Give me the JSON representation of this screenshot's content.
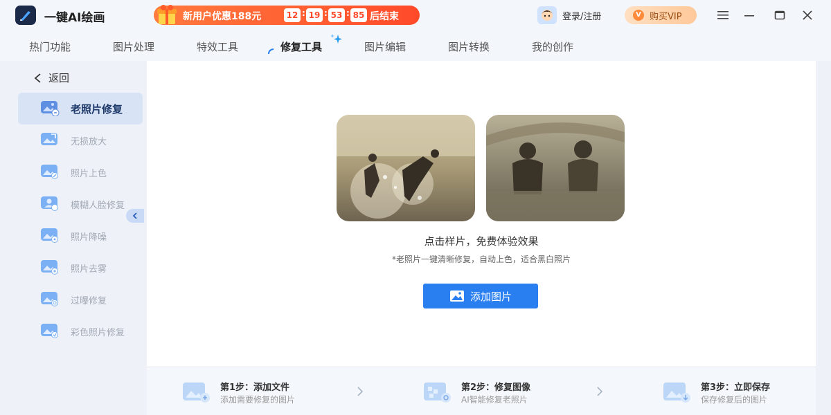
{
  "app": {
    "title": "一键AI绘画"
  },
  "promo": {
    "text": "新用户优惠188元",
    "countdown": [
      "12",
      "19",
      "53",
      "85"
    ],
    "end_text": "后结束"
  },
  "header": {
    "login_label": "登录/注册",
    "vip_badge": "V",
    "vip_label": "购买VIP"
  },
  "tabs": [
    {
      "label": "热门功能"
    },
    {
      "label": "图片处理"
    },
    {
      "label": "特效工具"
    },
    {
      "label": "修复工具"
    },
    {
      "label": "图片编辑"
    },
    {
      "label": "图片转换"
    },
    {
      "label": "我的创作"
    }
  ],
  "sidebar": {
    "back_label": "返回",
    "items": [
      {
        "label": "老照片修复"
      },
      {
        "label": "无损放大"
      },
      {
        "label": "照片上色"
      },
      {
        "label": "模糊人脸修复"
      },
      {
        "label": "照片降噪"
      },
      {
        "label": "照片去雾"
      },
      {
        "label": "过曝修复"
      },
      {
        "label": "彩色照片修复"
      }
    ]
  },
  "main": {
    "caption": "点击样片，免费体验效果",
    "subcaption": "*老照片一键清晰修复，自动上色，适合黑白照片",
    "add_button": "添加图片"
  },
  "steps": [
    {
      "title": "第1步：添加文件",
      "sub": "添加需要修复的图片"
    },
    {
      "title": "第2步：修复图像",
      "sub": "AI智能修复老照片"
    },
    {
      "title": "第3步：立即保存",
      "sub": "保存修复后的图片"
    }
  ],
  "colors": {
    "accent": "#2a7ff0",
    "promo": "#ff4a2a",
    "vip": "#ffc89a"
  }
}
